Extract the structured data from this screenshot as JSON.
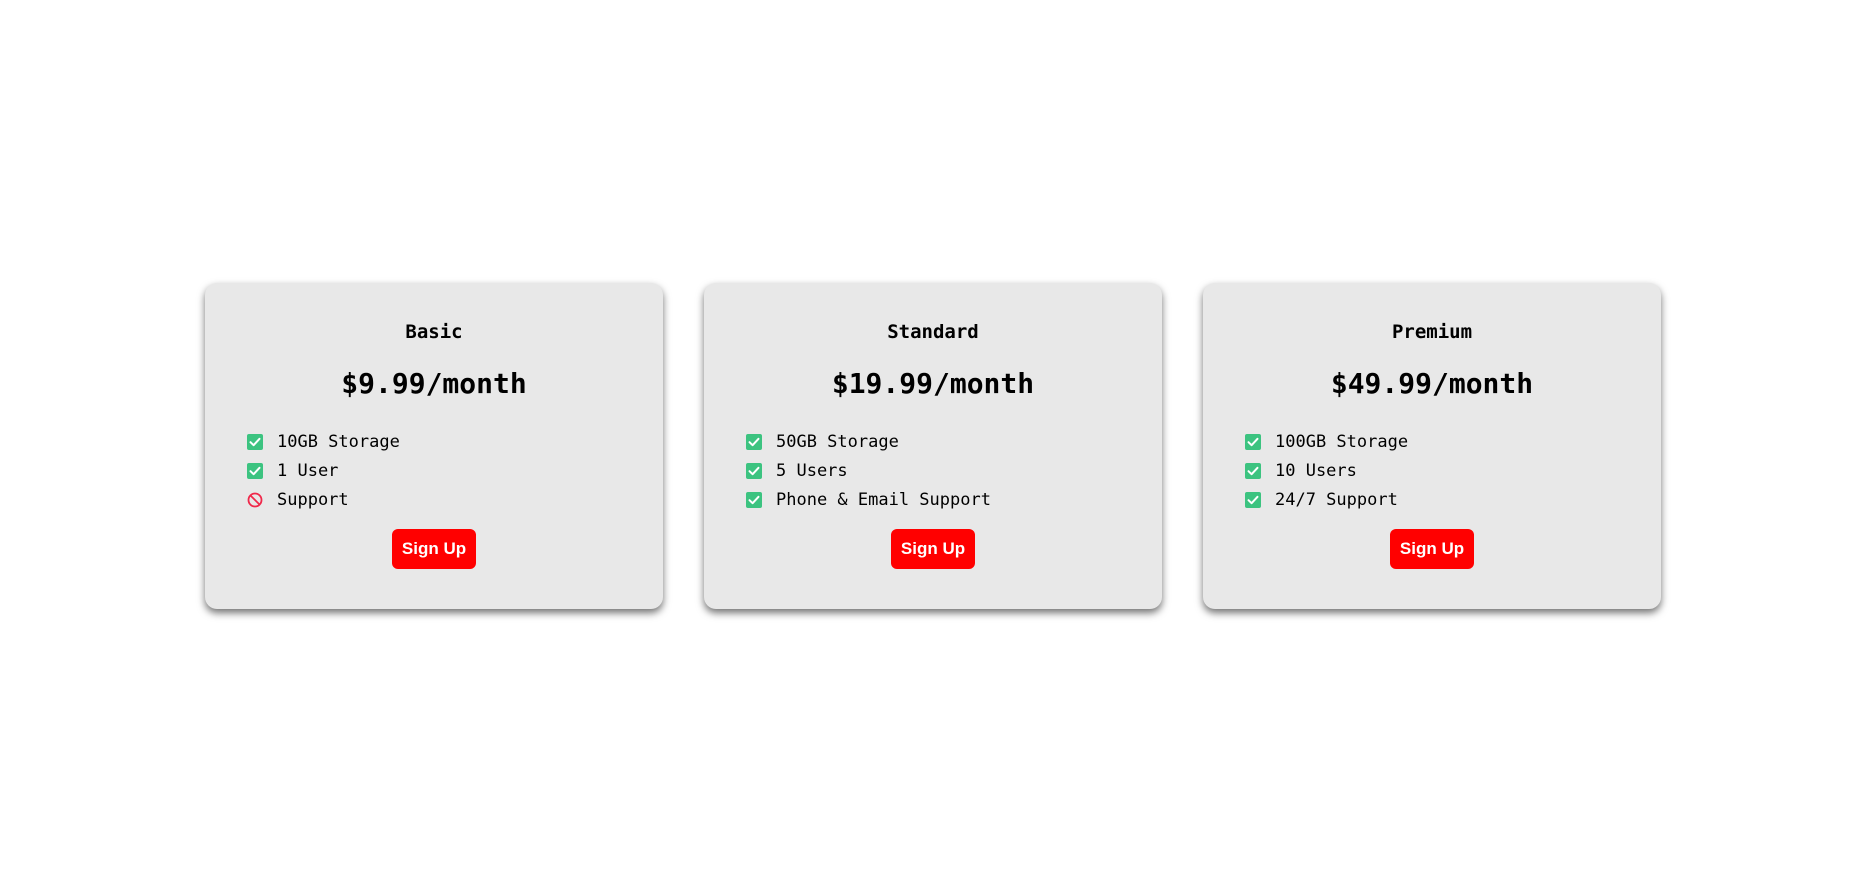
{
  "colors": {
    "accent": "#ff0000",
    "card_background": "#e8e8e8",
    "check": "#3cc380",
    "cross": "#f0284a"
  },
  "plans": [
    {
      "name": "Basic",
      "price": "$9.99/month",
      "features": [
        {
          "text": "10GB Storage",
          "icon": "check-box-icon"
        },
        {
          "text": "1 User",
          "icon": "check-box-icon"
        },
        {
          "text": "Support",
          "icon": "prohibited-icon"
        }
      ],
      "button_label": "Sign Up"
    },
    {
      "name": "Standard",
      "price": "$19.99/month",
      "features": [
        {
          "text": "50GB Storage",
          "icon": "check-box-icon"
        },
        {
          "text": "5 Users",
          "icon": "check-box-icon"
        },
        {
          "text": "Phone & Email Support",
          "icon": "check-box-icon"
        }
      ],
      "button_label": "Sign Up"
    },
    {
      "name": "Premium",
      "price": "$49.99/month",
      "features": [
        {
          "text": "100GB Storage",
          "icon": "check-box-icon"
        },
        {
          "text": "10 Users",
          "icon": "check-box-icon"
        },
        {
          "text": "24/7 Support",
          "icon": "check-box-icon"
        }
      ],
      "button_label": "Sign Up"
    }
  ]
}
